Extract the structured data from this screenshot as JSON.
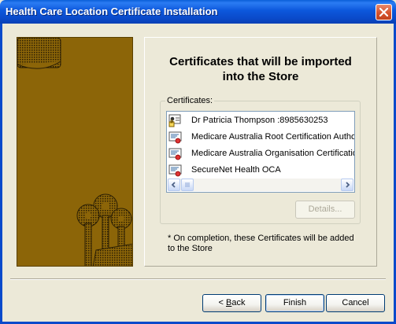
{
  "window": {
    "title": "Health Care Location Certificate Installation"
  },
  "panel": {
    "heading_line1": "Certificates that will be imported",
    "heading_line2": "into the Store",
    "group_label": "Certificates:",
    "certificates": [
      {
        "label": "Dr Patricia Thompson :8985630253",
        "icon": "personal-certificate-icon"
      },
      {
        "label": "Medicare Australia Root Certification Author",
        "icon": "certificate-icon"
      },
      {
        "label": "Medicare Australia Organisation Certification",
        "icon": "certificate-icon"
      },
      {
        "label": "SecureNet Health OCA",
        "icon": "certificate-icon"
      }
    ],
    "details_label": "Details...",
    "note": "* On completion, these Certificates will be added\n  to the Store"
  },
  "buttons": {
    "back_prefix": "< ",
    "back_underlined": "B",
    "back_rest": "ack",
    "finish": "Finish",
    "cancel": "Cancel"
  },
  "colors": {
    "title_bar": "#0A49C8",
    "dialog_bg": "#ECE9D8",
    "art_bg": "#8C6508"
  }
}
